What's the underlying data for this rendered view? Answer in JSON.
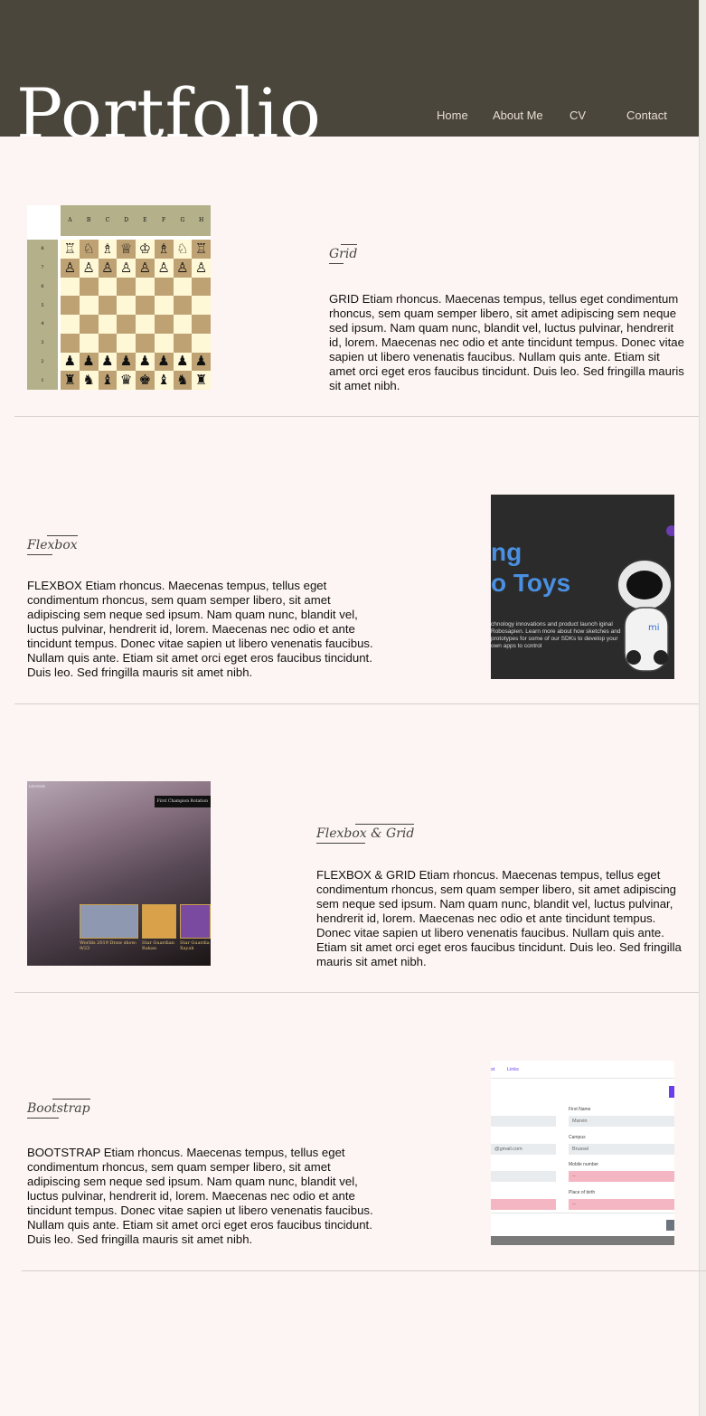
{
  "header": {
    "logo": "Portfolio",
    "nav": [
      {
        "label": "Home"
      },
      {
        "label": "About Me"
      },
      {
        "label": "CV"
      },
      {
        "label": "Contact"
      }
    ]
  },
  "sections": [
    {
      "title": "Grid",
      "body": "GRID Etiam rhoncus. Maecenas tempus, tellus eget condimentum rhoncus, sem quam semper libero, sit amet adipiscing sem neque sed ipsum. Nam quam nunc, blandit vel, luctus pulvinar, hendrerit id, lorem. Maecenas nec odio et ante tincidunt tempus. Donec vitae sapien ut libero venenatis faucibus. Nullam quis ante. Etiam sit amet orci eget eros faucibus tincidunt. Duis leo. Sed fringilla mauris sit amet nibh."
    },
    {
      "title": "Flexbox",
      "body": "FLEXBOX Etiam rhoncus. Maecenas tempus, tellus eget condimentum rhoncus, sem quam semper libero, sit amet adipiscing sem neque sed ipsum. Nam quam nunc, blandit vel, luctus pulvinar, hendrerit id, lorem. Maecenas nec odio et ante tincidunt tempus. Donec vitae sapien ut libero venenatis faucibus. Nullam quis ante. Etiam sit amet orci eget eros faucibus tincidunt. Duis leo. Sed fringilla mauris sit amet nibh."
    },
    {
      "title": "Flexbox & Grid",
      "body": "FLEXBOX & GRID Etiam rhoncus. Maecenas tempus, tellus eget condimentum rhoncus, sem quam semper libero, sit amet adipiscing sem neque sed ipsum. Nam quam nunc, blandit vel, luctus pulvinar, hendrerit id, lorem. Maecenas nec odio et ante tincidunt tempus. Donec vitae sapien ut libero venenatis faucibus. Nullam quis ante. Etiam sit amet orci eget eros faucibus tincidunt. Duis leo. Sed fringilla mauris sit amet nibh."
    },
    {
      "title": "Bootstrap",
      "body": "BOOTSTRAP Etiam rhoncus. Maecenas tempus, tellus eget condimentum rhoncus, sem quam semper libero, sit amet adipiscing sem neque sed ipsum. Nam quam nunc, blandit vel, luctus pulvinar, hendrerit id, lorem. Maecenas nec odio et ante tincidunt tempus. Donec vitae sapien ut libero venenatis faucibus. Nullam quis ante. Etiam sit amet orci eget eros faucibus tincidunt. Duis leo. Sed fringilla mauris sit amet nibh."
    }
  ],
  "chess": {
    "files": [
      "A",
      "B",
      "C",
      "D",
      "E",
      "F",
      "G",
      "H"
    ],
    "ranks": [
      "8",
      "7",
      "6",
      "5",
      "4",
      "3",
      "2",
      "1"
    ],
    "rows": [
      [
        "♖",
        "♘",
        "♗",
        "♕",
        "♔",
        "♗",
        "♘",
        "♖"
      ],
      [
        "♙",
        "♙",
        "♙",
        "♙",
        "♙",
        "♙",
        "♙",
        "♙"
      ],
      [
        "",
        "",
        "",
        "",
        "",
        "",
        "",
        ""
      ],
      [
        "",
        "",
        "",
        "",
        "",
        "",
        "",
        ""
      ],
      [
        "",
        "",
        "",
        "",
        "",
        "",
        "",
        ""
      ],
      [
        "",
        "",
        "",
        "",
        "",
        "",
        "",
        ""
      ],
      [
        "♟",
        "♟",
        "♟",
        "♟",
        "♟",
        "♟",
        "♟",
        "♟"
      ],
      [
        "♜",
        "♞",
        "♝",
        "♛",
        "♚",
        "♝",
        "♞",
        "♜"
      ]
    ]
  },
  "robot": {
    "line1": "ng",
    "line2": "o Toys",
    "blurb": "chnology innovations and product launch iginal Robosapien. Learn more about how sketches and prototypes for some of our SDKs to develop your own apps to control"
  },
  "league": {
    "brand": "LEAGUE",
    "tag": "First Champion Rotation",
    "cards": [
      {
        "label": "Worlds 2019 Draw show: 9/23"
      },
      {
        "label": "Star Guardian Rakan"
      },
      {
        "label": "Star Guardia Xayah"
      }
    ]
  },
  "form": {
    "tabs": [
      "st",
      "Links"
    ],
    "labels": [
      "First Name",
      "Campus",
      "Mobile number",
      "Place of birth"
    ],
    "values": [
      "Marvin",
      "Brussel",
      "--",
      "--"
    ],
    "left_values": [
      "",
      "@gmail.com",
      "",
      ""
    ]
  }
}
